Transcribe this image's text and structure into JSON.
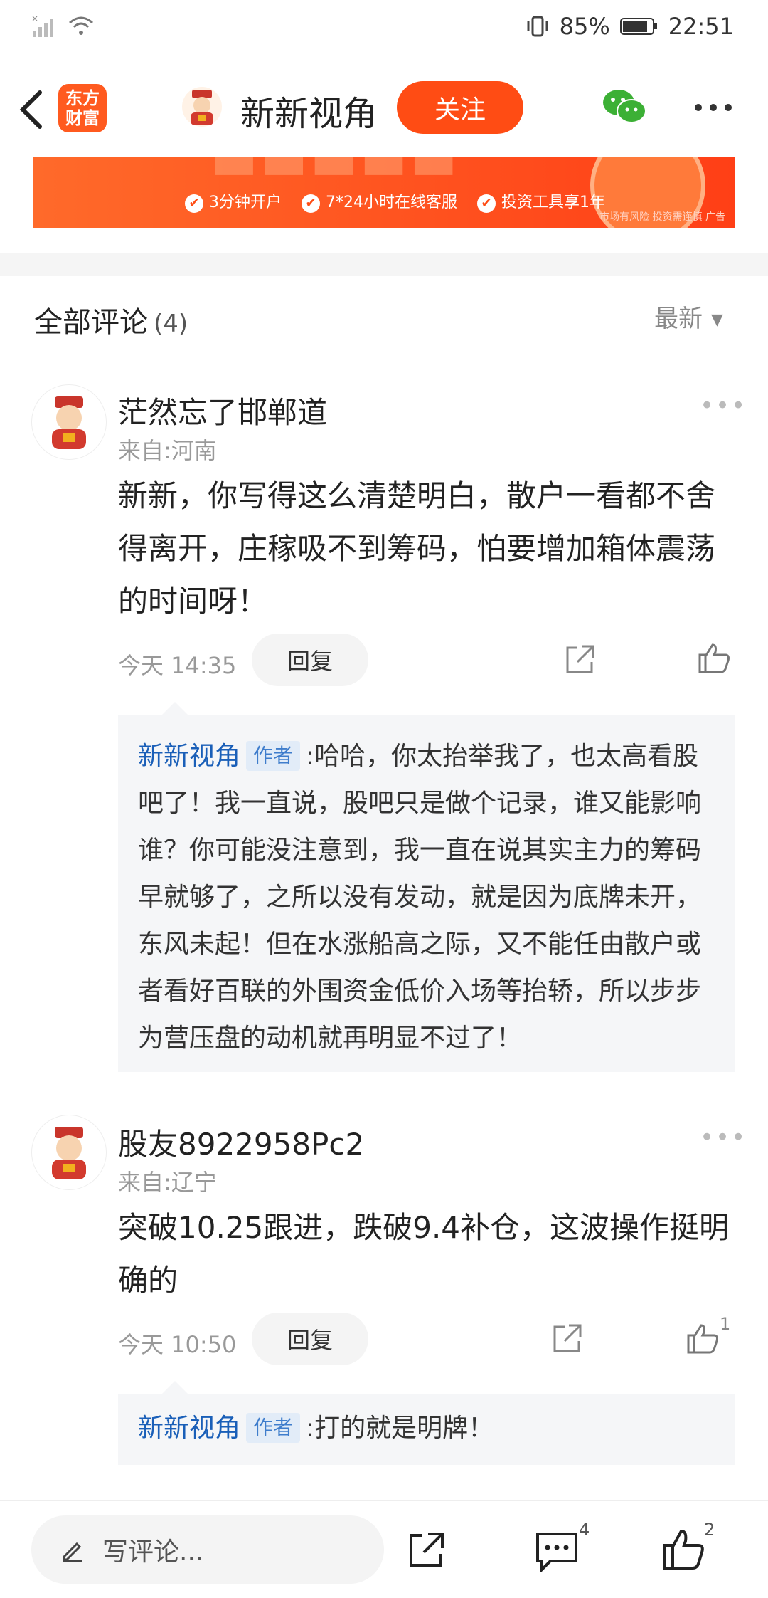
{
  "status_bar": {
    "battery": "85%",
    "time": "22:51"
  },
  "nav": {
    "logo_text": "东方财富",
    "title": "新新视角",
    "follow_label": "关注"
  },
  "ad": {
    "items": [
      "3分钟开户",
      "7*24小时在线客服",
      "投资工具享1年"
    ],
    "note": "市场有风险 投资需谨慎 广告"
  },
  "comments_header": {
    "title": "全部评论",
    "count": "(4)",
    "sort_label": "最新"
  },
  "comments": [
    {
      "name": "茫然忘了邯郸道",
      "from": "来自:河南",
      "body": "新新，你写得这么清楚明白，散户一看都不舍得离开，庄稼吸不到筹码，怕要增加箱体震荡的时间呀！",
      "time": "今天 14:35",
      "reply_label": "回复",
      "likes": "",
      "reply": {
        "author": "新新视角",
        "tag": "作者",
        "text": ":哈哈，你太抬举我了，也太高看股吧了！我一直说，股吧只是做个记录，谁又能影响谁？你可能没注意到，我一直在说其实主力的筹码早就够了，之所以没有发动，就是因为底牌未开，东风未起！但在水涨船高之际，又不能任由散户或者看好百联的外围资金低价入场等抬轿，所以步步为营压盘的动机就再明显不过了！"
      }
    },
    {
      "name": "股友8922958Pc2",
      "from": "来自:辽宁",
      "body": "突破10.25跟进，跌破9.4补仓，这波操作挺明确的",
      "time": "今天 10:50",
      "reply_label": "回复",
      "likes": "1",
      "reply": {
        "author": "新新视角",
        "tag": "作者",
        "text": ":打的就是明牌！"
      }
    }
  ],
  "bottom_bar": {
    "placeholder": "写评论...",
    "comment_count": "4",
    "like_count": "2"
  },
  "colors": {
    "accent": "#ff4c14",
    "link_blue": "#1a5fb8"
  }
}
